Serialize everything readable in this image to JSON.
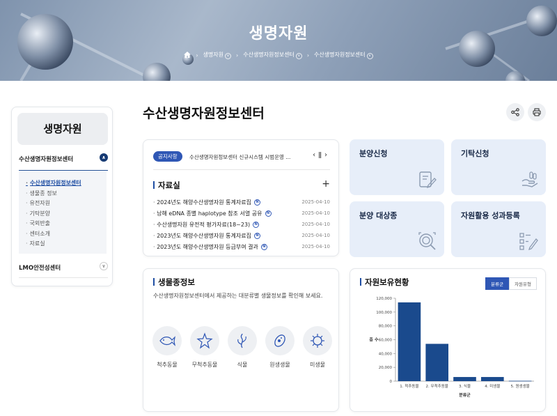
{
  "hero": {
    "title": "생명자원",
    "breadcrumb": [
      "생명자원",
      "수산생명자원정보센터",
      "수산생명자원정보센터"
    ]
  },
  "sidebar": {
    "title": "생명자원",
    "section1": "수산생명자원정보센터",
    "items": [
      "수산생명자원정보센터",
      "생물종 정보",
      "유전자원",
      "기탁분양",
      "국외반출",
      "센터소개",
      "자료실"
    ],
    "section2": "LMO안전성센터"
  },
  "page": {
    "title": "수산생명자원정보센터"
  },
  "notice": {
    "label": "공지사항",
    "text": "수산생명자원정보센터 신규시스템 시범운영 ..."
  },
  "archive": {
    "title": "자료실",
    "items": [
      {
        "title": "2024년도 해양수산생명자원 통계자료집",
        "date": "2025-04-10"
      },
      {
        "title": "남해 eDNA 종별 haplotype 참조 서열 공유",
        "date": "2025-04-10"
      },
      {
        "title": "수산생명자원 유전적 평가자료(18~23)",
        "date": "2025-04-10"
      },
      {
        "title": "2023년도 해양수산생명자원 통계자료집",
        "date": "2025-04-10"
      },
      {
        "title": "2023년도 해양수산생명자원 등급부여 결과",
        "date": "2025-04-10"
      }
    ],
    "new_badge": "N"
  },
  "tiles": {
    "distribution": "분양신청",
    "deposit": "기탁신청",
    "targets": "분양 대상종",
    "results": "자원활용 성과등록"
  },
  "species": {
    "title": "생물종정보",
    "desc": "수산생명자원정보센터에서 제공하는 대분류별 생물정보를 확인해 보세요.",
    "categories": [
      {
        "name": "척추동물",
        "icon": "fish-icon"
      },
      {
        "name": "무척추동물",
        "icon": "starfish-icon"
      },
      {
        "name": "식물",
        "icon": "seaweed-icon"
      },
      {
        "name": "원생생물",
        "icon": "protist-icon"
      },
      {
        "name": "미생물",
        "icon": "microbe-icon"
      }
    ]
  },
  "holdings": {
    "title": "자원보유현황",
    "tabs": [
      "분류군",
      "자원유형"
    ]
  },
  "colors": {
    "primary": "#2f57b5",
    "navy": "#163a73",
    "bar": "#1a4a8d",
    "tile": "#e7eef9"
  },
  "chart_data": {
    "type": "bar",
    "categories": [
      "1. 척추동물",
      "2. 무척추동물",
      "3. 식물",
      "4. 미생물",
      "5. 원생생물"
    ],
    "values": [
      114000,
      54000,
      6000,
      6000,
      500
    ],
    "xlabel": "분류군",
    "ylabel": "종 수",
    "ylim": [
      0,
      120000
    ],
    "yticks": [
      "0",
      "20,000",
      "40,000",
      "60,000",
      "80,000",
      "100,000",
      "120,000"
    ],
    "grid": false,
    "legend": "none"
  }
}
